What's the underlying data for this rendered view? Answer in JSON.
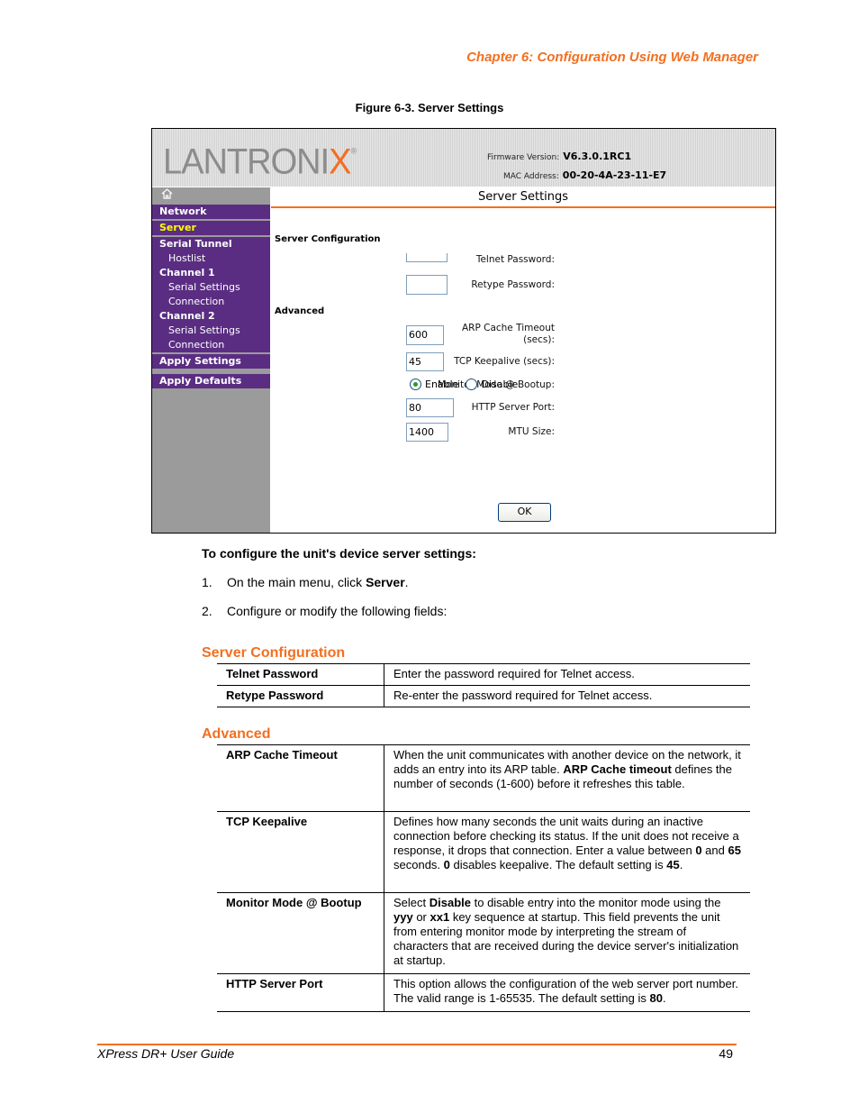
{
  "header": {
    "chapter": "Chapter 6: Configuration Using Web Manager"
  },
  "figure": {
    "caption": "Figure 6-3. Server Settings"
  },
  "screenshot": {
    "logo": {
      "text_main": "LANTRONI",
      "text_accent": "X",
      "registered": "®"
    },
    "firmware_label": "Firmware Version:",
    "firmware_value": "V6.3.0.1RC1",
    "mac_label": "MAC Address:",
    "mac_value": "00-20-4A-23-11-E7",
    "home_icon": "home-icon",
    "nav": {
      "network": "Network",
      "server": "Server",
      "serial_tunnel": "Serial Tunnel",
      "hostlist": "Hostlist",
      "channel1": "Channel 1",
      "ch1_serial": "Serial Settings",
      "ch1_connection": "Connection",
      "channel2": "Channel 2",
      "ch2_serial": "Serial Settings",
      "ch2_connection": "Connection",
      "apply_settings": "Apply Settings",
      "apply_defaults": "Apply Defaults"
    },
    "page_title": "Server Settings",
    "sections": {
      "server_config": "Server Configuration",
      "advanced": "Advanced"
    },
    "fields": {
      "telnet_password": {
        "label": "Telnet Password:",
        "value": ""
      },
      "retype_password": {
        "label": "Retype Password:",
        "value": ""
      },
      "arp_timeout": {
        "label_line1": "ARP Cache Timeout",
        "label_line2": "(secs):",
        "value": "600"
      },
      "tcp_keepalive": {
        "label": "TCP Keepalive (secs):",
        "value": "45"
      },
      "monitor_mode": {
        "label": "Monitor Mode @ Bootup:",
        "options": [
          "Enable",
          "Disable"
        ],
        "selected": "Enable"
      },
      "http_port": {
        "label": "HTTP Server Port:",
        "value": "80"
      },
      "mtu_size": {
        "label": "MTU Size:",
        "value": "1400"
      }
    },
    "ok_button": "OK"
  },
  "instructions": {
    "heading": "To configure the unit's device server settings:",
    "steps": [
      {
        "num": "1.",
        "text_before": "On the main menu, click ",
        "bold": "Server",
        "text_after": "."
      },
      {
        "num": "2.",
        "text_before": "Configure or modify the following fields:",
        "bold": "",
        "text_after": ""
      }
    ]
  },
  "tables": {
    "server_config": {
      "title": "Server Configuration",
      "rows": [
        {
          "field": "Telnet Password",
          "desc": "Enter the password required for Telnet access."
        },
        {
          "field": "Retype Password",
          "desc": "Re-enter the password required for Telnet access."
        }
      ]
    },
    "advanced": {
      "title": "Advanced",
      "rows": [
        {
          "field": "ARP Cache Timeout",
          "desc_parts": [
            "When the unit communicates with another device on the network, it adds an entry into its ARP table. ",
            "ARP Cache timeout",
            " defines the number of seconds (1-600) before it refreshes this table."
          ]
        },
        {
          "field": "TCP Keepalive",
          "desc_parts": [
            "Defines how many seconds the unit waits during an inactive connection before checking its status. If the unit does not receive a response, it drops that connection. Enter a value between ",
            "0",
            " and ",
            "65",
            " seconds. ",
            "0",
            " disables keepalive. The default setting is ",
            "45",
            "."
          ]
        },
        {
          "field": "Monitor Mode @ Bootup",
          "desc_parts": [
            "Select ",
            "Disable",
            " to disable entry into the monitor mode using the ",
            "yyy",
            " or ",
            "xx1",
            " key sequence at startup. This field prevents the unit from entering monitor mode by interpreting the stream of characters that are received during the device server's initialization at startup."
          ]
        },
        {
          "field": "HTTP Server Port",
          "desc_parts": [
            "This option allows the configuration of the web server port number. The valid range is 1-65535. The default setting is ",
            "80",
            "."
          ]
        }
      ]
    }
  },
  "footer": {
    "title": "XPress DR+ User Guide",
    "page": "49"
  },
  "colors": {
    "accent_orange": "#f26f21",
    "nav_purple": "#5a2d82",
    "nav_active": "#ffff00",
    "sidebar_gray": "#9b9b9b"
  }
}
